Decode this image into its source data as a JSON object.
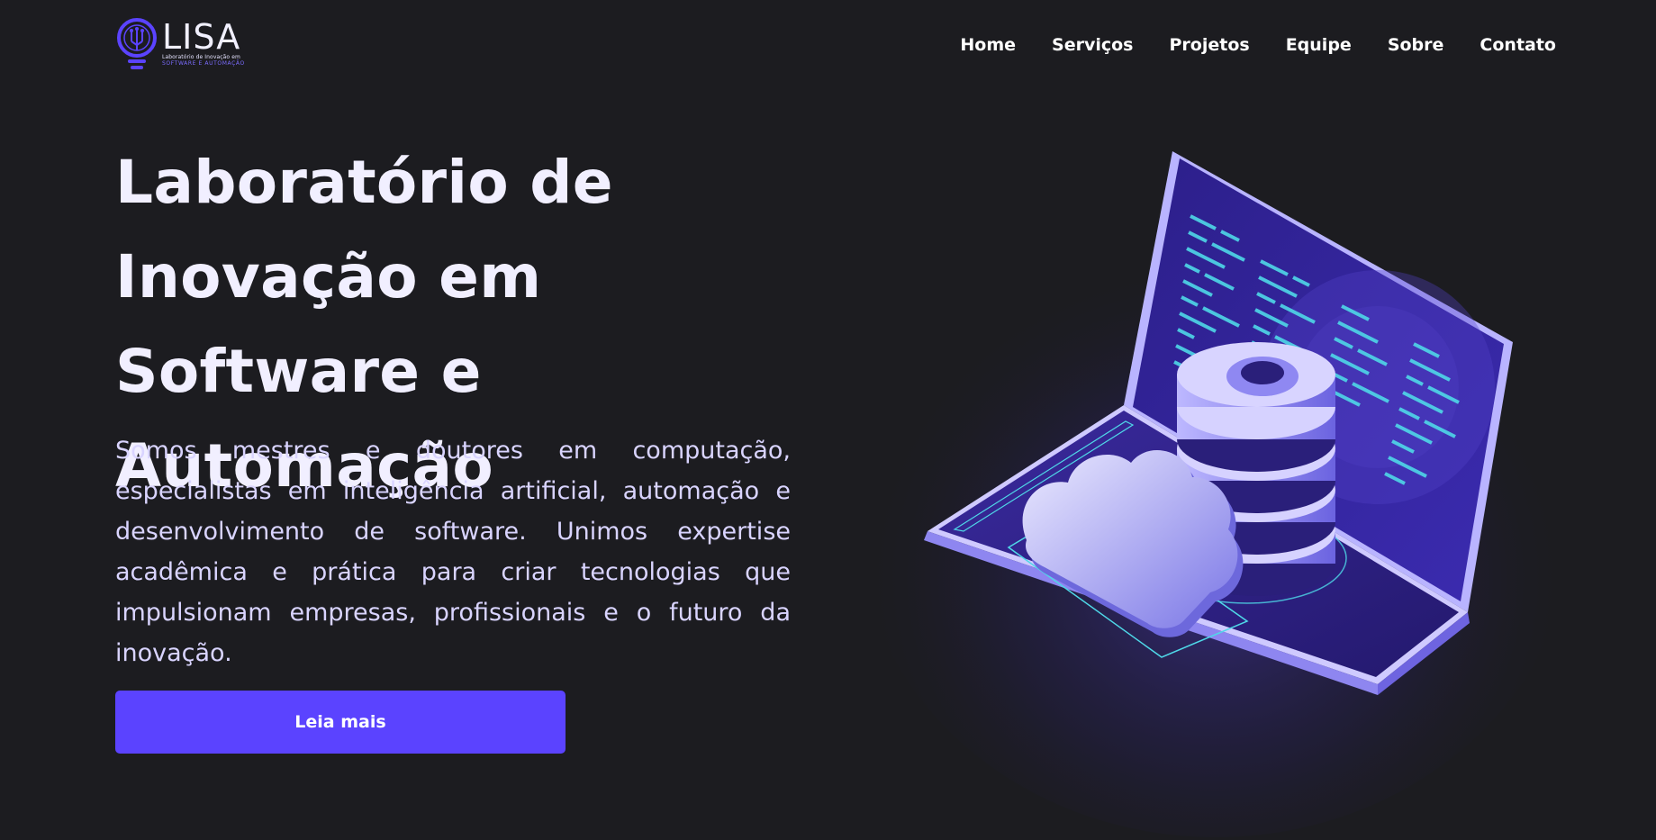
{
  "header": {
    "logo": {
      "word": "LISA",
      "subtitle_line1": "Laboratório de Inovação em",
      "subtitle_line2": "SOFTWARE E AUTOMAÇÃO"
    },
    "nav": [
      {
        "label": "Home"
      },
      {
        "label": "Serviços"
      },
      {
        "label": "Projetos"
      },
      {
        "label": "Equipe"
      },
      {
        "label": "Sobre"
      },
      {
        "label": "Contato"
      }
    ]
  },
  "hero": {
    "title": "Laboratório de Inovação em Software e Automação",
    "description": "Somos mestres e doutores em computação, especialistas em inteligência artificial, automação e desenvolvimento de software. Unimos expertise acadêmica e prática para criar tecnologias que impulsionam empresas, profissionais e o futuro da inovação.",
    "cta_label": "Leia mais"
  },
  "colors": {
    "background": "#1c1c20",
    "accent": "#5b43ff",
    "title": "#f1efff",
    "body_text": "#d9d4ff"
  },
  "icons": {
    "logo": "lightbulb-circuit-icon",
    "illustration": "laptop-database-cloud-illustration"
  }
}
